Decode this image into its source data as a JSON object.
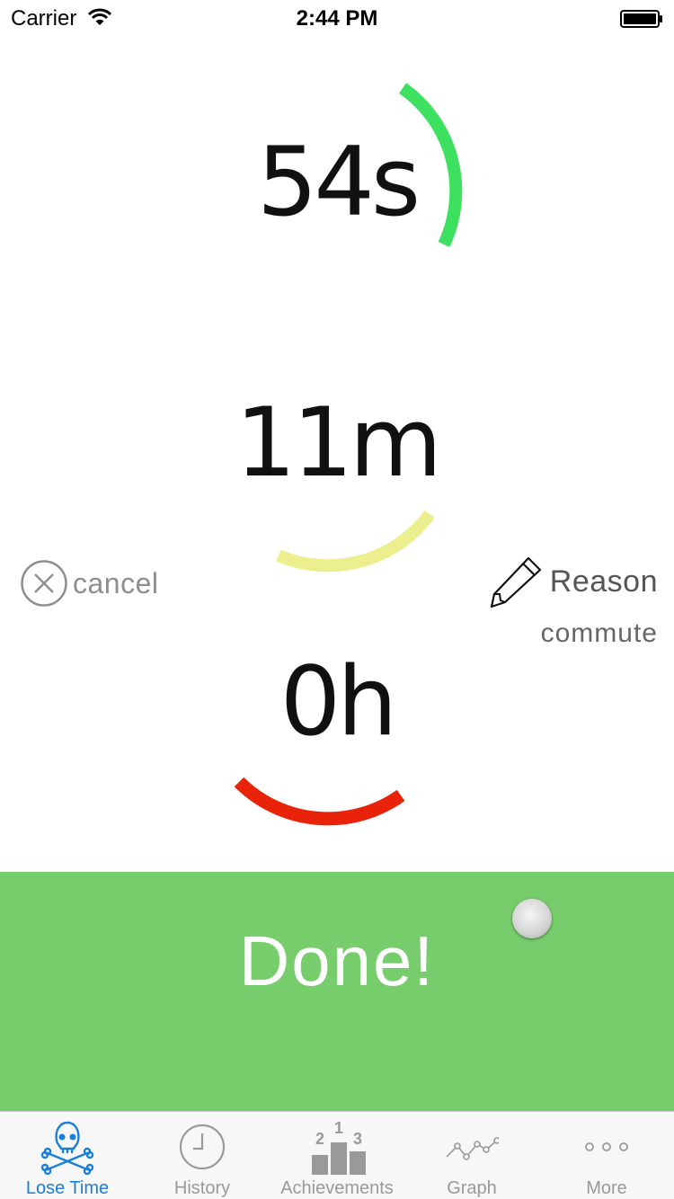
{
  "status_bar": {
    "carrier": "Carrier",
    "time": "2:44 PM"
  },
  "timer": {
    "seconds": "54s",
    "minutes": "11m",
    "hours": "0h",
    "seconds_ring": {
      "color": "#3ee060",
      "fraction": 0.15
    },
    "minutes_ring": {
      "color": "#ebef8e",
      "fraction": 0.18
    },
    "hours_ring": {
      "color": "#e8230a",
      "fraction": 0.0
    }
  },
  "actions": {
    "cancel_label": "cancel",
    "reason_label": "Reason",
    "reason_value": "commute",
    "done_label": "Done!"
  },
  "colors": {
    "done_background": "#77cd6b",
    "tab_active": "#1a7fd6",
    "tab_inactive": "#999999"
  },
  "tabs": [
    {
      "label": "Lose Time",
      "icon": "skull-crossbones-icon",
      "active": true
    },
    {
      "label": "History",
      "icon": "clock-icon",
      "active": false
    },
    {
      "label": "Achievements",
      "icon": "podium-icon",
      "active": false
    },
    {
      "label": "Graph",
      "icon": "line-graph-icon",
      "active": false
    },
    {
      "label": "More",
      "icon": "more-dots-icon",
      "active": false
    }
  ],
  "achievements_podium": {
    "first": "1",
    "second": "2",
    "third": "3"
  }
}
